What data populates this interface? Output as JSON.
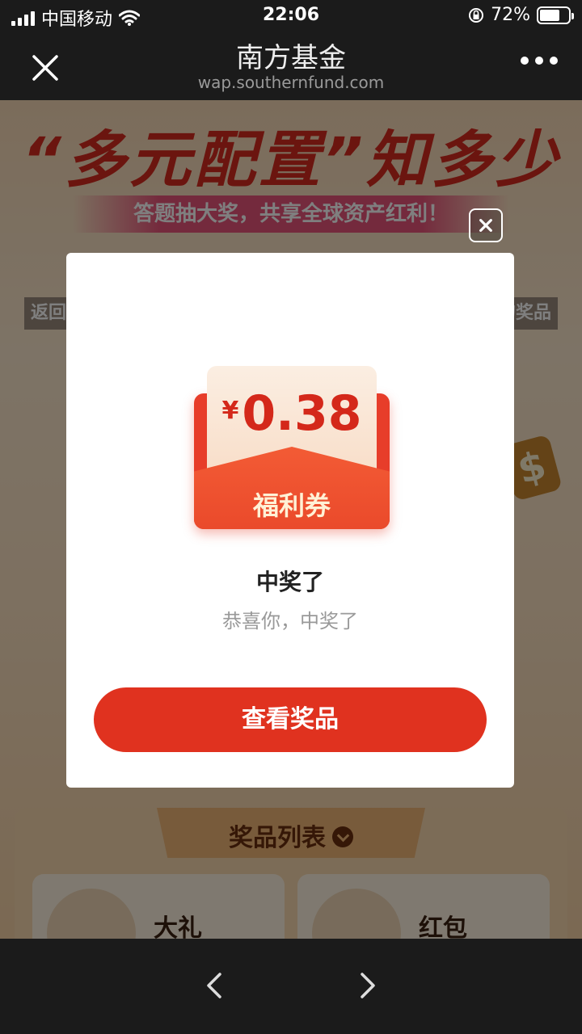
{
  "status_bar": {
    "carrier": "中国移动",
    "time": "22:06",
    "battery": "72%",
    "battery_level": 0.72
  },
  "nav": {
    "title": "南方基金",
    "url": "wap.southernfund.com"
  },
  "background": {
    "banner_title": "“多元配置”知多少",
    "banner_subtitle": "答题抽大奖，共享全球资产红利！",
    "left_button": "返回",
    "right_button": "的奖品",
    "prize_section_title": "奖品列表",
    "prizes": [
      {
        "name": "大礼"
      },
      {
        "name": "红包"
      }
    ]
  },
  "modal": {
    "currency": "¥",
    "amount": "0.38",
    "coupon_label": "福利券",
    "title": "中奖了",
    "message": "恭喜你，中奖了",
    "button_label": "查看奖品"
  }
}
